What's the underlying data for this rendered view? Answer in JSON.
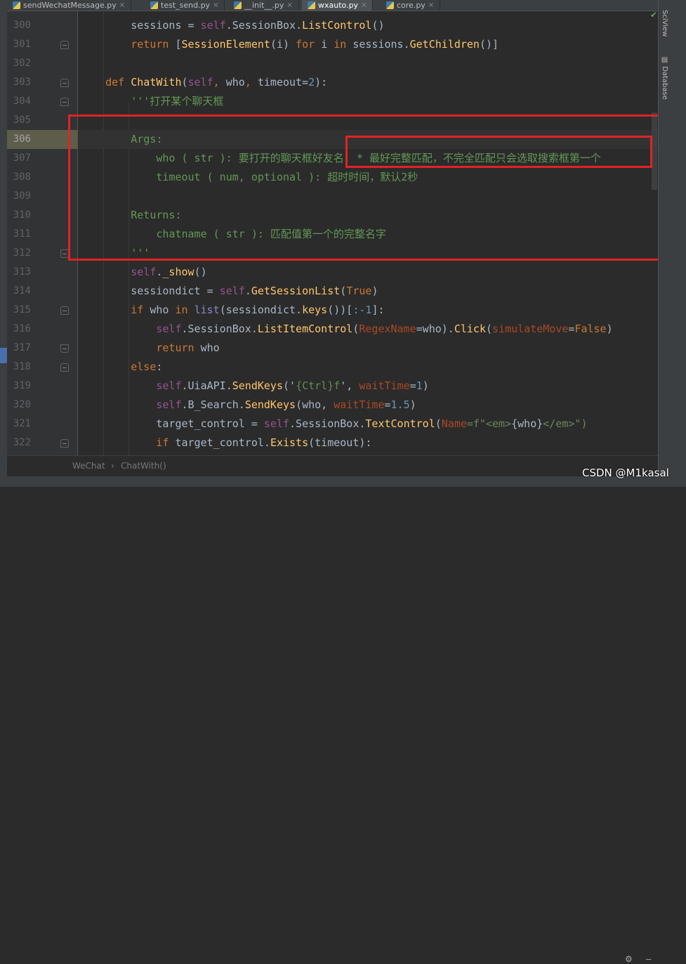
{
  "tabs": [
    {
      "label": "sendWechatMessage.py",
      "active": false
    },
    {
      "label": "test_send.py",
      "active": false
    },
    {
      "label": "__init__.py",
      "active": false
    },
    {
      "label": "wxauto.py",
      "active": true
    },
    {
      "label": "core.py",
      "active": false
    }
  ],
  "side_panels": {
    "top_label": "SciView",
    "bottom_label": "Database"
  },
  "lines": [
    {
      "n": "300",
      "segs": [
        [
          "        sessions = ",
          "#a9b7c6"
        ],
        [
          "self",
          "#94558d"
        ],
        [
          ".",
          "#a9b7c6"
        ],
        [
          "SessionBox",
          "#a9b7c6"
        ],
        [
          ".",
          "#a9b7c6"
        ],
        [
          "ListControl",
          "#ffc66d"
        ],
        [
          "()",
          "#a9b7c6"
        ]
      ]
    },
    {
      "n": "301",
      "segs": [
        [
          "        ",
          "#a9b7c6"
        ],
        [
          "return ",
          "#cc7832"
        ],
        [
          "[",
          "#a9b7c6"
        ],
        [
          "SessionElement",
          "#ffc66d"
        ],
        [
          "(i) ",
          "#a9b7c6"
        ],
        [
          "for ",
          "#cc7832"
        ],
        [
          "i ",
          "#a9b7c6"
        ],
        [
          "in ",
          "#cc7832"
        ],
        [
          "sessions.",
          "#a9b7c6"
        ],
        [
          "GetChildren",
          "#ffc66d"
        ],
        [
          "()]",
          "#a9b7c6"
        ]
      ]
    },
    {
      "n": "302",
      "segs": []
    },
    {
      "n": "303",
      "segs": [
        [
          "    ",
          "#a9b7c6"
        ],
        [
          "def ",
          "#cc7832"
        ],
        [
          "ChatWith",
          "#ffc66d"
        ],
        [
          "(",
          "#a9b7c6"
        ],
        [
          "self",
          "#94558d"
        ],
        [
          ", ",
          "#cc7832"
        ],
        [
          "who",
          "#a9b7c6"
        ],
        [
          ", ",
          "#cc7832"
        ],
        [
          "timeout",
          "#a9b7c6"
        ],
        [
          "=",
          "#a9b7c6"
        ],
        [
          "2",
          "#6897bb"
        ],
        [
          "):",
          "#a9b7c6"
        ]
      ]
    },
    {
      "n": "304",
      "segs": [
        [
          "        '''打开某个聊天框",
          "#629755"
        ]
      ]
    },
    {
      "n": "305",
      "segs": []
    },
    {
      "n": "306",
      "segs": [
        [
          "        Args:",
          "#629755"
        ]
      ]
    },
    {
      "n": "307",
      "segs": [
        [
          "            who ( str ): 要打开的聊天框好友名; * 最好完整匹配，不完全匹配只会选取搜索框第一个",
          "#629755"
        ]
      ]
    },
    {
      "n": "308",
      "segs": [
        [
          "            timeout ( num, optional ): 超时时间，默认2秒",
          "#629755"
        ]
      ]
    },
    {
      "n": "309",
      "segs": []
    },
    {
      "n": "310",
      "segs": [
        [
          "        Returns:",
          "#629755"
        ]
      ]
    },
    {
      "n": "311",
      "segs": [
        [
          "            chatname ( str ): 匹配值第一个的完整名字",
          "#629755"
        ]
      ]
    },
    {
      "n": "312",
      "segs": [
        [
          "        '''",
          "#629755"
        ]
      ]
    },
    {
      "n": "313",
      "segs": [
        [
          "        ",
          "#a9b7c6"
        ],
        [
          "self",
          "#94558d"
        ],
        [
          ".",
          "#a9b7c6"
        ],
        [
          "_show",
          "#ffc66d"
        ],
        [
          "()",
          "#a9b7c6"
        ]
      ]
    },
    {
      "n": "314",
      "segs": [
        [
          "        sessiondict = ",
          "#a9b7c6"
        ],
        [
          "self",
          "#94558d"
        ],
        [
          ".",
          "#a9b7c6"
        ],
        [
          "GetSessionList",
          "#ffc66d"
        ],
        [
          "(",
          "#a9b7c6"
        ],
        [
          "True",
          "#cc7832"
        ],
        [
          ")",
          "#a9b7c6"
        ]
      ]
    },
    {
      "n": "315",
      "segs": [
        [
          "        ",
          "#a9b7c6"
        ],
        [
          "if ",
          "#cc7832"
        ],
        [
          "who ",
          "#a9b7c6"
        ],
        [
          "in ",
          "#cc7832"
        ],
        [
          "list",
          "#8888c6"
        ],
        [
          "(sessiondict.",
          "#a9b7c6"
        ],
        [
          "keys",
          "#ffc66d"
        ],
        [
          "())[",
          "#a9b7c6"
        ],
        [
          ":-1",
          "#6897bb"
        ],
        [
          "]:",
          "#a9b7c6"
        ]
      ]
    },
    {
      "n": "316",
      "segs": [
        [
          "            ",
          "#a9b7c6"
        ],
        [
          "self",
          "#94558d"
        ],
        [
          ".SessionBox.",
          "#a9b7c6"
        ],
        [
          "ListItemControl",
          "#ffc66d"
        ],
        [
          "(",
          "#a9b7c6"
        ],
        [
          "RegexName",
          "#aa4926"
        ],
        [
          "=who).",
          "#a9b7c6"
        ],
        [
          "Click",
          "#ffc66d"
        ],
        [
          "(",
          "#a9b7c6"
        ],
        [
          "simulateMove",
          "#aa4926"
        ],
        [
          "=",
          "#a9b7c6"
        ],
        [
          "False",
          "#cc7832"
        ],
        [
          ")",
          "#a9b7c6"
        ]
      ]
    },
    {
      "n": "317",
      "segs": [
        [
          "            ",
          "#a9b7c6"
        ],
        [
          "return ",
          "#cc7832"
        ],
        [
          "who",
          "#a9b7c6"
        ]
      ]
    },
    {
      "n": "318",
      "segs": [
        [
          "        ",
          "#a9b7c6"
        ],
        [
          "else",
          "#cc7832"
        ],
        [
          ":",
          "#a9b7c6"
        ]
      ]
    },
    {
      "n": "319",
      "segs": [
        [
          "            ",
          "#a9b7c6"
        ],
        [
          "self",
          "#94558d"
        ],
        [
          ".UiaAPI.",
          "#a9b7c6"
        ],
        [
          "SendKeys",
          "#ffc66d"
        ],
        [
          "('",
          "#a9b7c6"
        ],
        [
          "{Ctrl}f",
          "#6a8759"
        ],
        [
          "', ",
          "#a9b7c6"
        ],
        [
          "waitTime",
          "#aa4926"
        ],
        [
          "=",
          "#a9b7c6"
        ],
        [
          "1",
          "#6897bb"
        ],
        [
          ")",
          "#a9b7c6"
        ]
      ]
    },
    {
      "n": "320",
      "segs": [
        [
          "            ",
          "#a9b7c6"
        ],
        [
          "self",
          "#94558d"
        ],
        [
          ".B_Search.",
          "#a9b7c6"
        ],
        [
          "SendKeys",
          "#ffc66d"
        ],
        [
          "(who, ",
          "#a9b7c6"
        ],
        [
          "waitTime",
          "#aa4926"
        ],
        [
          "=",
          "#a9b7c6"
        ],
        [
          "1.5",
          "#6897bb"
        ],
        [
          ")",
          "#a9b7c6"
        ]
      ]
    },
    {
      "n": "321",
      "segs": [
        [
          "            target_control = ",
          "#a9b7c6"
        ],
        [
          "self",
          "#94558d"
        ],
        [
          ".SessionBox.",
          "#a9b7c6"
        ],
        [
          "TextControl",
          "#ffc66d"
        ],
        [
          "(",
          "#a9b7c6"
        ],
        [
          "Name",
          "#aa4926"
        ],
        [
          "=f\"<em>",
          "#6a8759"
        ],
        [
          "{who}",
          "#a9b7c6"
        ],
        [
          "</em>\")",
          "#6a8759"
        ]
      ]
    },
    {
      "n": "322",
      "segs": [
        [
          "            ",
          "#a9b7c6"
        ],
        [
          "if ",
          "#cc7832"
        ],
        [
          "target_control.",
          "#a9b7c6"
        ],
        [
          "Exists",
          "#ffc66d"
        ],
        [
          "(timeout):",
          "#a9b7c6"
        ]
      ]
    }
  ],
  "breadcrumb": [
    "WeChat",
    "ChatWith()"
  ],
  "watermark": "CSDN @M1kasal"
}
